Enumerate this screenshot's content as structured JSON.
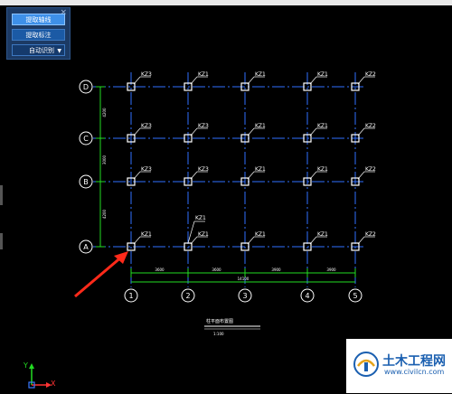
{
  "top_strip_text": "· · ·",
  "tool_panel": {
    "close_label": "×",
    "buttons": [
      {
        "label": "提取轴线",
        "active": true
      },
      {
        "label": "提取标注",
        "active": false
      },
      {
        "label": "自动识别",
        "active": false,
        "dropdown": true
      }
    ],
    "dropdown_caret": "▼"
  },
  "drawing": {
    "row_axes": [
      "D",
      "C",
      "B",
      "A"
    ],
    "column_axes": [
      "1",
      "2",
      "3",
      "4",
      "5"
    ],
    "column_labels": [
      [
        "KZ3",
        "KZ1",
        "KZ1",
        "KZ1",
        "KZ2"
      ],
      [
        "KZ3",
        "KZ3",
        "KZ1",
        "KZ1",
        "KZ2"
      ],
      [
        "KZ3",
        "KZ3",
        "KZ1",
        "KZ1",
        "KZ2"
      ],
      [
        "KZ1",
        "KZ1",
        "KZ1",
        "KZ1",
        "KZ2"
      ]
    ],
    "extra_label": "KZ1",
    "vertical_dims": [
      "4200",
      "3000",
      "4200"
    ],
    "horizontal_dims": [
      "3600",
      "3600",
      "3900",
      "3900"
    ],
    "total_dim": "14100",
    "title": "柱平面布置图",
    "subtitle": "1:100"
  },
  "ucs": {
    "y_label": "Y",
    "x_label": "X"
  },
  "watermark": {
    "title": "土木工程网",
    "url": "www.civilcn.com"
  },
  "colors": {
    "background": "#000000",
    "axis_line": "#2f6fff",
    "column": "#ffffff",
    "dimension": "#22dd22",
    "arrow": "#ff2a1a",
    "panel": "#1c3a64"
  }
}
